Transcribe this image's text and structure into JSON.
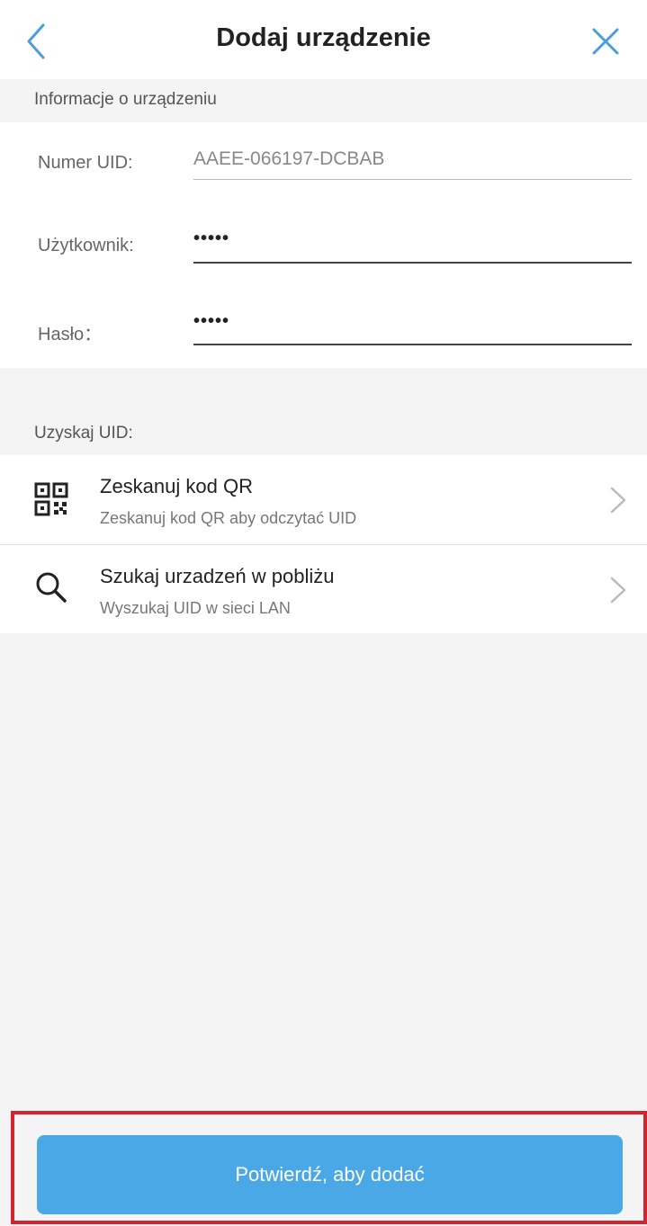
{
  "header": {
    "title": "Dodaj urządzenie",
    "back_icon": "chevron-left-icon",
    "close_icon": "close-icon"
  },
  "device_info": {
    "section_label": "Informacje o urządzeniu",
    "uid_label": "Numer UID:",
    "uid_value": "AAEE-066197-DCBAB",
    "user_label": "Użytkownik:",
    "user_value": "•••••",
    "password_label": "Hasło：",
    "password_value": "•••••"
  },
  "get_uid": {
    "section_label": "Uzyskaj UID:",
    "options": [
      {
        "icon": "qr-code-icon",
        "title": "Zeskanuj kod QR",
        "subtitle": "Zeskanuj kod QR aby odczytać UID"
      },
      {
        "icon": "search-icon",
        "title": "Szukaj urzadzeń w pobliżu",
        "subtitle": "Wyszukaj UID w sieci LAN"
      }
    ]
  },
  "confirm": {
    "label": "Potwierdź, aby dodać"
  },
  "colors": {
    "accent": "#4aa8e6",
    "highlight": "#d6242f",
    "background": "#f4f4f4"
  }
}
